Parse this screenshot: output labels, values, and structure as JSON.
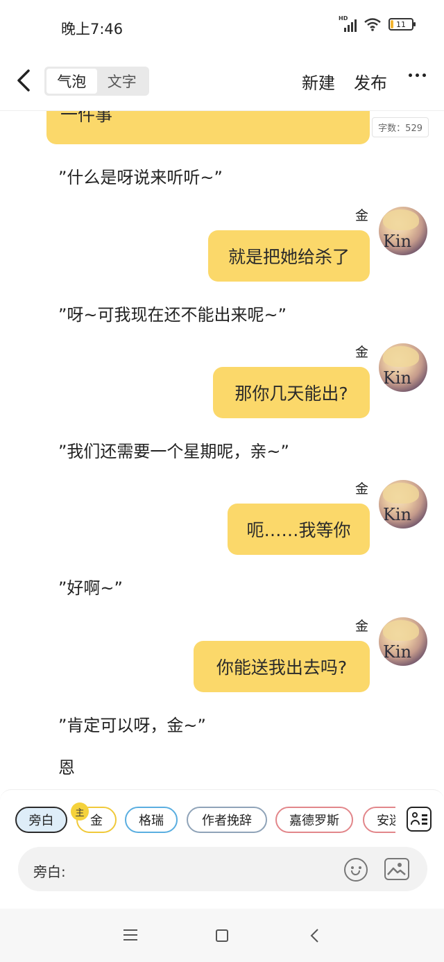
{
  "status": {
    "time": "晚上7:46",
    "network": "HD",
    "battery": "11",
    "battery_level": 0.11
  },
  "header": {
    "tabs": [
      {
        "label": "气泡",
        "active": true
      },
      {
        "label": "文字",
        "active": false
      }
    ],
    "new_label": "新建",
    "publish_label": "发布"
  },
  "word_count": "字数：529",
  "messages": {
    "bubble0": "一件事",
    "n1": "”什么是呀说来听听~”",
    "s1": "金",
    "b1": "就是把她给杀了",
    "n2": "”呀~可我现在还不能出来呢~”",
    "s2": "金",
    "b2": "那你几天能出?",
    "n3": "”我们还需要一个星期呢，亲~”",
    "s3": "金",
    "b3": "呃……我等你",
    "n4": "”好啊~”",
    "s4": "金",
    "b4": "你能送我出去吗?",
    "n5": "”肯定可以呀，金~”",
    "n6": "恩"
  },
  "avatar_text": "Kin",
  "roles": {
    "items": [
      "旁白",
      "金",
      "格瑞",
      "作者挽辞",
      "嘉德罗斯",
      "安迷"
    ],
    "colors": [
      "#2a2a2a",
      "#f0c93a",
      "#5aaee0",
      "#8fa3b8",
      "#e2868a",
      "#e2868a"
    ],
    "main_badge": "主"
  },
  "input": {
    "label": "旁白:",
    "placeholder": ""
  }
}
